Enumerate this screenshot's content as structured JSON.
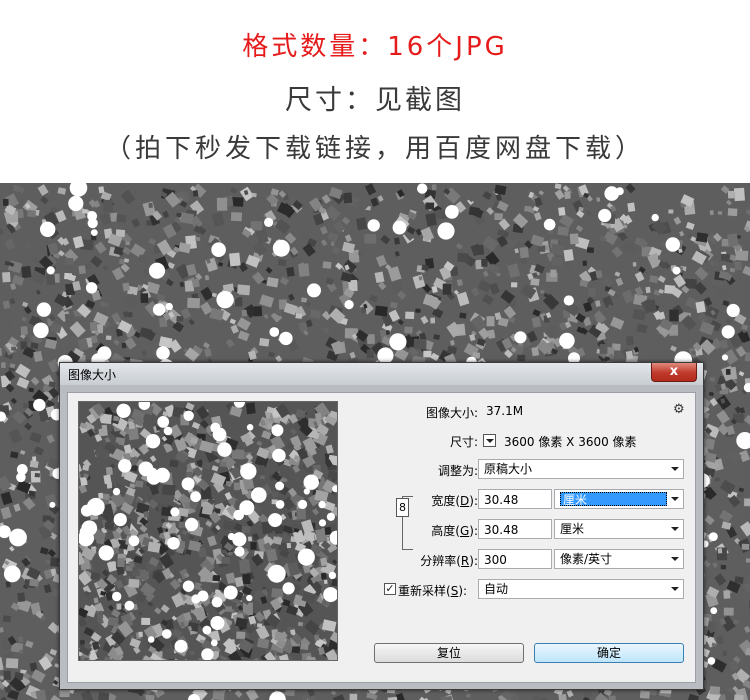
{
  "header": {
    "line1": "格式数量：16个JPG",
    "line2": "尺寸：见截图",
    "line3": "（拍下秒发下载链接，用百度网盘下载）"
  },
  "dialog": {
    "title": "图像大小",
    "close_glyph": "x",
    "image_size_label": "图像大小:",
    "image_size_value": "37.1M",
    "gear_icon": "⚙",
    "dimensions_label": "尺寸:",
    "dimensions_value": "3600 像素  X  3600 像素",
    "fit_to_label": "调整为:",
    "fit_to_value": "原稿大小",
    "width_label": "宽度(D):",
    "width_value": "30.48",
    "width_unit": "厘米",
    "height_label": "高度(G):",
    "height_value": "30.48",
    "height_unit": "厘米",
    "resolution_label": "分辨率(R):",
    "resolution_value": "300",
    "resolution_unit": "像素/英寸",
    "resample_label": "重新采样(S):",
    "resample_checked": true,
    "resample_value": "自动",
    "reset_button": "复位",
    "ok_button": "确定"
  }
}
